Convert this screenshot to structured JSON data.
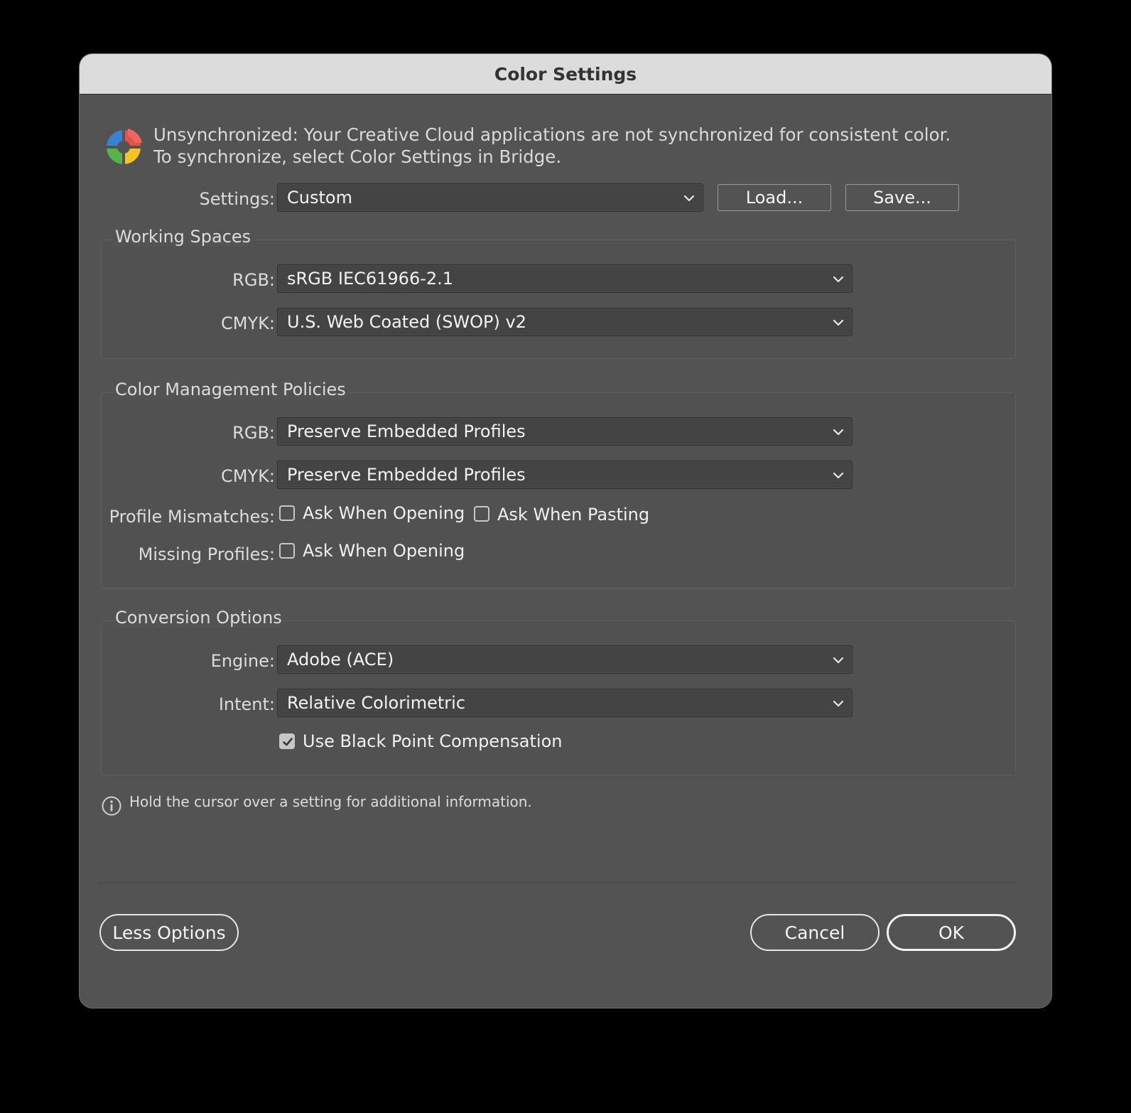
{
  "dialog": {
    "title": "Color Settings"
  },
  "sync": {
    "icon": "color-sync-icon",
    "message": "Unsynchronized: Your Creative Cloud applications are not synchronized for consistent color. To synchronize, select Color Settings in Bridge."
  },
  "settings": {
    "label": "Settings:",
    "value": "Custom",
    "load_label": "Load...",
    "save_label": "Save..."
  },
  "working_spaces": {
    "title": "Working Spaces",
    "rgb_label": "RGB:",
    "rgb_value": "sRGB IEC61966-2.1",
    "cmyk_label": "CMYK:",
    "cmyk_value": "U.S. Web Coated (SWOP) v2"
  },
  "policies": {
    "title": "Color Management Policies",
    "rgb_label": "RGB:",
    "rgb_value": "Preserve Embedded Profiles",
    "cmyk_label": "CMYK:",
    "cmyk_value": "Preserve Embedded Profiles",
    "mismatch_label": "Profile Mismatches:",
    "mismatch_opening_label": "Ask When Opening",
    "mismatch_opening_checked": false,
    "mismatch_pasting_label": "Ask When Pasting",
    "mismatch_pasting_checked": false,
    "missing_label": "Missing Profiles:",
    "missing_opening_label": "Ask When Opening",
    "missing_opening_checked": false
  },
  "conversion": {
    "title": "Conversion Options",
    "engine_label": "Engine:",
    "engine_value": "Adobe (ACE)",
    "intent_label": "Intent:",
    "intent_value": "Relative Colorimetric",
    "bpc_label": "Use Black Point Compensation",
    "bpc_checked": true
  },
  "info": {
    "icon": "info-icon",
    "text": "Hold the cursor over a setting for additional information."
  },
  "footer": {
    "less_options_label": "Less Options",
    "cancel_label": "Cancel",
    "ok_label": "OK"
  }
}
